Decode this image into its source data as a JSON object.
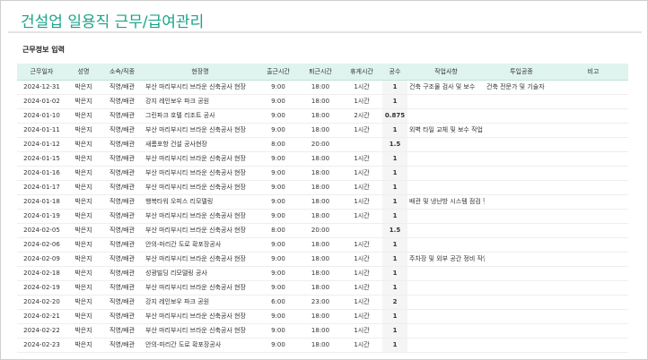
{
  "app": {
    "title": "건설업 일용직 근무/급여관리"
  },
  "section": {
    "title": "근무정보 입력"
  },
  "table": {
    "columns": [
      "근무일자",
      "성명",
      "소속/직종",
      "현장명",
      "출근시간",
      "퇴근시간",
      "휴게시간",
      "공수",
      "작업사항",
      "투입공종",
      "비고"
    ],
    "rows": [
      [
        "2024-12-31",
        "박은지",
        "직영/배관",
        "부산 마리부시티 브라운 신축공사 현장",
        "9:00",
        "18:00",
        "1시간",
        "1",
        "건축 구조물 검사 및 보수",
        "건축 전문가 및 기술자",
        ""
      ],
      [
        "2024-01-02",
        "박은지",
        "직영/배관",
        "강지 레인보우 파크 공원",
        "9:00",
        "18:00",
        "1시간",
        "1",
        "",
        "",
        ""
      ],
      [
        "2024-01-10",
        "박은지",
        "직영/배관",
        "그린파크 호텔 리조트 공사",
        "9:00",
        "18:00",
        "2시간",
        "0.875",
        "",
        "",
        ""
      ],
      [
        "2024-01-11",
        "박은지",
        "직영/배관",
        "부산 마리부시티 브라운 신축공사 현장",
        "9:00",
        "18:00",
        "1시간",
        "1",
        "외벽 타일 교체 및 보수 작업",
        "",
        ""
      ],
      [
        "2024-01-12",
        "박은지",
        "직영/배관",
        "새롬포항 건설 공사현장",
        "8:00",
        "20:00",
        "",
        "1.5",
        "",
        "",
        ""
      ],
      [
        "2024-01-15",
        "박은지",
        "직영/배관",
        "부산 마리부시티 브라운 신축공사 현장",
        "9:00",
        "18:00",
        "1시간",
        "1",
        "",
        "",
        ""
      ],
      [
        "2024-01-16",
        "박은지",
        "직영/배관",
        "부산 마리부시티 브라운 신축공사 현장",
        "9:00",
        "18:00",
        "1시간",
        "1",
        "",
        "",
        ""
      ],
      [
        "2024-01-17",
        "박은지",
        "직영/배관",
        "부산 마리부시티 브라운 신축공사 현장",
        "9:00",
        "18:00",
        "1시간",
        "1",
        "",
        "",
        ""
      ],
      [
        "2024-01-18",
        "박은지",
        "직영/배관",
        "행복타워 오피스 리모델링",
        "9:00",
        "18:00",
        "1시간",
        "1",
        "배관 및 냉난방 시스템 점검 및 유지보수 작업",
        "",
        ""
      ],
      [
        "2024-01-19",
        "박은지",
        "직영/배관",
        "부산 마리부시티 브라운 신축공사 현장",
        "9:00",
        "18:00",
        "1시간",
        "1",
        "",
        "",
        ""
      ],
      [
        "2024-02-05",
        "박은지",
        "직영/배관",
        "부산 마리부시티 브라운 신축공사 현장",
        "8:00",
        "20:00",
        "",
        "1.5",
        "",
        "",
        ""
      ],
      [
        "2024-02-06",
        "박은지",
        "직영/배관",
        "안의-마리간 도로 확포장공사",
        "9:00",
        "18:00",
        "1시간",
        "1",
        "",
        "",
        ""
      ],
      [
        "2024-02-09",
        "박은지",
        "직영/배관",
        "부산 마리부시티 브라운 신축공사 현장",
        "9:00",
        "18:00",
        "1시간",
        "1",
        "주차장 및 외부 공간 정비 작업",
        "",
        ""
      ],
      [
        "2024-02-18",
        "박은지",
        "직영/배관",
        "성광빌딩 리모델링 공사",
        "9:00",
        "18:00",
        "1시간",
        "1",
        "",
        "",
        ""
      ],
      [
        "2024-02-19",
        "박은지",
        "직영/배관",
        "부산 마리부시티 브라운 신축공사 현장",
        "9:00",
        "18:00",
        "1시간",
        "1",
        "",
        "",
        ""
      ],
      [
        "2024-02-20",
        "박은지",
        "직영/배관",
        "강지 레인보우 파크 공원",
        "6:00",
        "23:00",
        "1시간",
        "2",
        "",
        "",
        ""
      ],
      [
        "2024-02-21",
        "박은지",
        "직영/배관",
        "부산 마리부시티 브라운 신축공사 현장",
        "9:00",
        "18:00",
        "1시간",
        "1",
        "",
        "",
        ""
      ],
      [
        "2024-02-22",
        "박은지",
        "직영/배관",
        "부산 마리부시티 브라운 신축공사 현장",
        "9:00",
        "18:00",
        "1시간",
        "1",
        "",
        "",
        ""
      ],
      [
        "2024-02-23",
        "박은지",
        "직영/배관",
        "안의-마리간 도로 확포장공사",
        "9:00",
        "18:00",
        "1시간",
        "1",
        "",
        "",
        ""
      ]
    ]
  },
  "colors": {
    "accent": "#1aa38a",
    "header_bg": "#dff4ee"
  }
}
